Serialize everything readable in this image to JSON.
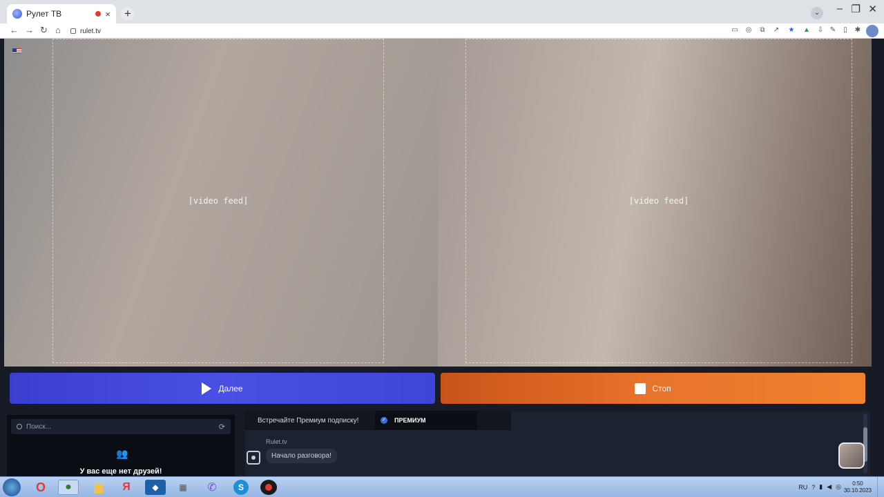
{
  "browser": {
    "tab_title": "Рулет ТВ",
    "url": "rulet.tv"
  },
  "main": {
    "left_video": "[video feed]",
    "right_video": "[video feed]",
    "next_label": "Далее",
    "stop_label": "Стоп"
  },
  "friends": {
    "search_placeholder": "Поиск...",
    "empty_text": "У вас еще нет друзей!"
  },
  "chat": {
    "premium_prompt": "Встречайте Премиум подписку!",
    "premium_button": "ПРЕМИУМ",
    "sender": "Rulet.tv",
    "message": "Начало разговора!"
  },
  "taskbar": {
    "language": "RU",
    "time": "0:50",
    "date": "30.10.2023"
  },
  "colors": {
    "next_button": "#3f45d8",
    "stop_button": "#e8742c",
    "page_bg": "#161b26"
  },
  "icons": [
    "browser-favicon",
    "recording-dot",
    "close-icon",
    "plus-icon",
    "back-arrow-icon",
    "forward-arrow-icon",
    "reload-icon",
    "lock-icon",
    "star-icon",
    "extension-icon",
    "us-flag-icon",
    "play-icon",
    "stop-square-icon",
    "search-icon",
    "refresh-icon",
    "friends-icon",
    "bot-icon",
    "check-icon",
    "start-icon"
  ]
}
